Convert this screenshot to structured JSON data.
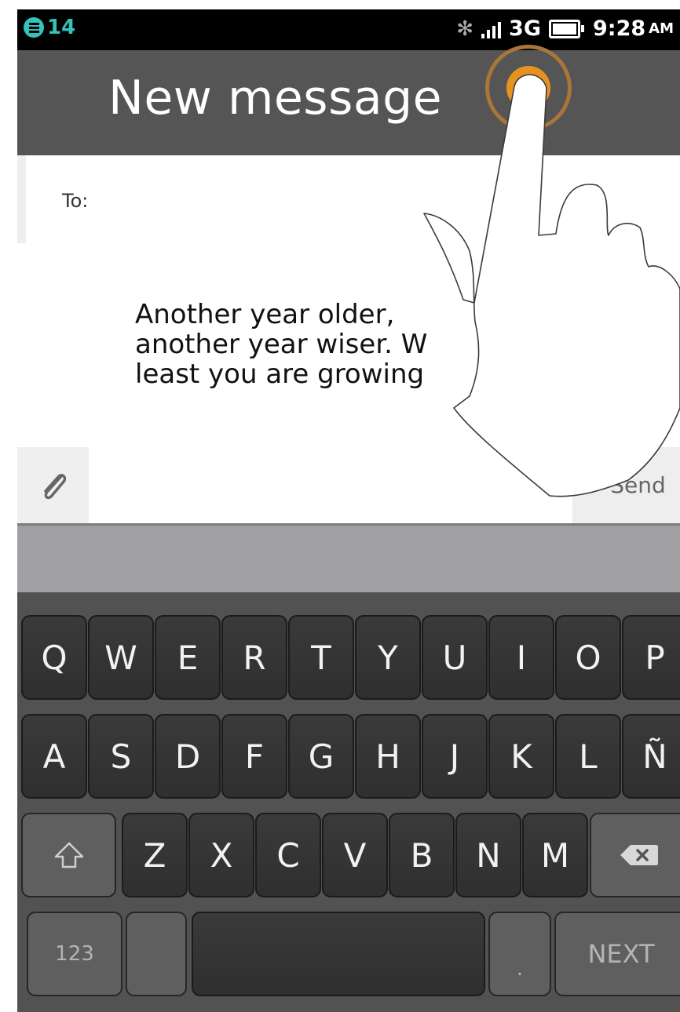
{
  "status_bar": {
    "notification_count": "14",
    "network": "3G",
    "time": "9:28",
    "ampm": "AM"
  },
  "header": {
    "title": "New message"
  },
  "compose": {
    "to_label": "To:",
    "message_lines": "Another year older,\nanother year wiser. W\nleast you are growing",
    "send_label": "Send"
  },
  "keyboard": {
    "row1": [
      "Q",
      "W",
      "E",
      "R",
      "T",
      "Y",
      "U",
      "I",
      "O",
      "P"
    ],
    "row2": [
      "A",
      "S",
      "D",
      "F",
      "G",
      "H",
      "J",
      "K",
      "L",
      "Ñ"
    ],
    "row3": [
      "Z",
      "X",
      "C",
      "V",
      "B",
      "N",
      "M"
    ],
    "numbers_label": "123",
    "period_label": ".",
    "next_label": "NEXT"
  },
  "icons": {
    "notification": "notification-icon",
    "bluetooth": "bluetooth-icon",
    "signal": "signal-icon",
    "battery": "battery-icon",
    "attach": "paperclip-icon",
    "shift": "shift-icon",
    "backspace": "backspace-icon",
    "hand": "pointing-hand-icon"
  }
}
